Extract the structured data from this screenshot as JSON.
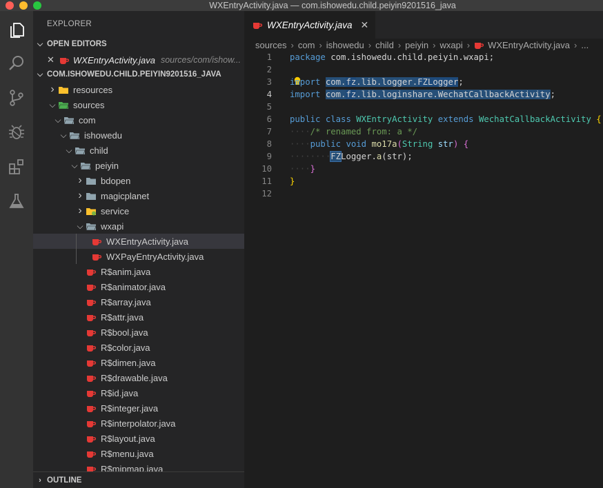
{
  "window": {
    "title": "WXEntryActivity.java — com.ishowedu.child.peiyin9201516_java"
  },
  "activity_bar": {
    "icons": [
      "files-icon",
      "search-icon",
      "source-control-icon",
      "debug-icon",
      "extensions-icon",
      "testing-icon"
    ]
  },
  "sidebar": {
    "title": "EXPLORER",
    "open_editors": {
      "header": "OPEN EDITORS",
      "items": [
        {
          "name": "WXEntryActivity.java",
          "path": "sources/com/ishow..."
        }
      ]
    },
    "project": {
      "header": "COM.ISHOWEDU.CHILD.PEIYIN9201516_JAVA",
      "tree": [
        {
          "label": "resources",
          "depth": 0,
          "kind": "folder-res",
          "expanded": false
        },
        {
          "label": "sources",
          "depth": 0,
          "kind": "folder-src",
          "expanded": true
        },
        {
          "label": "com",
          "depth": 1,
          "kind": "folder",
          "expanded": true
        },
        {
          "label": "ishowedu",
          "depth": 2,
          "kind": "folder",
          "expanded": true
        },
        {
          "label": "child",
          "depth": 3,
          "kind": "folder",
          "expanded": true
        },
        {
          "label": "peiyin",
          "depth": 4,
          "kind": "folder",
          "expanded": true
        },
        {
          "label": "bdopen",
          "depth": 5,
          "kind": "folder",
          "expanded": false
        },
        {
          "label": "magicplanet",
          "depth": 5,
          "kind": "folder",
          "expanded": false
        },
        {
          "label": "service",
          "depth": 5,
          "kind": "folder-svc",
          "expanded": false
        },
        {
          "label": "wxapi",
          "depth": 5,
          "kind": "folder",
          "expanded": true
        },
        {
          "label": "WXEntryActivity.java",
          "depth": 6,
          "kind": "java",
          "selected": true
        },
        {
          "label": "WXPayEntryActivity.java",
          "depth": 6,
          "kind": "java"
        },
        {
          "label": "R$anim.java",
          "depth": 5,
          "kind": "java"
        },
        {
          "label": "R$animator.java",
          "depth": 5,
          "kind": "java"
        },
        {
          "label": "R$array.java",
          "depth": 5,
          "kind": "java"
        },
        {
          "label": "R$attr.java",
          "depth": 5,
          "kind": "java"
        },
        {
          "label": "R$bool.java",
          "depth": 5,
          "kind": "java"
        },
        {
          "label": "R$color.java",
          "depth": 5,
          "kind": "java"
        },
        {
          "label": "R$dimen.java",
          "depth": 5,
          "kind": "java"
        },
        {
          "label": "R$drawable.java",
          "depth": 5,
          "kind": "java"
        },
        {
          "label": "R$id.java",
          "depth": 5,
          "kind": "java"
        },
        {
          "label": "R$integer.java",
          "depth": 5,
          "kind": "java"
        },
        {
          "label": "R$interpolator.java",
          "depth": 5,
          "kind": "java"
        },
        {
          "label": "R$layout.java",
          "depth": 5,
          "kind": "java"
        },
        {
          "label": "R$menu.java",
          "depth": 5,
          "kind": "java"
        },
        {
          "label": "R$mipmap.java",
          "depth": 5,
          "kind": "java"
        }
      ]
    },
    "outline": {
      "header": "OUTLINE"
    }
  },
  "editor": {
    "tab": {
      "label": "WXEntryActivity.java",
      "close": "✕"
    },
    "breadcrumb": [
      "sources",
      "com",
      "ishowedu",
      "child",
      "peiyin",
      "wxapi",
      "WXEntryActivity.java",
      "..."
    ],
    "active_line": 4,
    "lines": [
      [
        [
          "kw",
          "package"
        ],
        [
          "t",
          " com.ishowedu.child.peiyin.wxapi;"
        ]
      ],
      [],
      [
        [
          "kw",
          "import"
        ],
        [
          "t",
          " "
        ],
        [
          "hl",
          "com."
        ],
        [
          "hl2",
          "fz"
        ],
        [
          "hl",
          ".lib.logger."
        ],
        [
          "hl2",
          "FZLogger"
        ],
        [
          "t",
          ";"
        ]
      ],
      [
        [
          "kw",
          "import"
        ],
        [
          "t",
          " "
        ],
        [
          "hl",
          "com."
        ],
        [
          "hl2",
          "fz"
        ],
        [
          "hl",
          ".lib.loginshare.WechatCallbackActivity"
        ],
        [
          "t",
          ";"
        ]
      ],
      [],
      [
        [
          "kw",
          "public"
        ],
        [
          "t",
          " "
        ],
        [
          "kw",
          "class"
        ],
        [
          "t",
          " "
        ],
        [
          "cls",
          "WXEntryActivity"
        ],
        [
          "t",
          " "
        ],
        [
          "kw",
          "extends"
        ],
        [
          "t",
          " "
        ],
        [
          "cls",
          "WechatCallbackActivity"
        ],
        [
          "t",
          " "
        ],
        [
          "pn1",
          "{"
        ]
      ],
      [
        [
          "ws",
          "····"
        ],
        [
          "cmt",
          "/* renamed from: a */"
        ]
      ],
      [
        [
          "ws",
          "····"
        ],
        [
          "kw",
          "public"
        ],
        [
          "t",
          " "
        ],
        [
          "kw",
          "void"
        ],
        [
          "t",
          " "
        ],
        [
          "fn",
          "mo17a"
        ],
        [
          "pn2",
          "("
        ],
        [
          "cls",
          "String"
        ],
        [
          "t",
          " "
        ],
        [
          "prm",
          "str"
        ],
        [
          "pn2",
          ")"
        ],
        [
          "t",
          " "
        ],
        [
          "pn2",
          "{"
        ]
      ],
      [
        [
          "ws",
          "····"
        ],
        [
          "ws",
          "····"
        ],
        [
          "sel",
          "FZ"
        ],
        [
          "t",
          "Logger."
        ],
        [
          "fn",
          "a"
        ],
        [
          "t",
          "(str);"
        ]
      ],
      [
        [
          "ws",
          "····"
        ],
        [
          "pn2",
          "}"
        ]
      ],
      [
        [
          "pn1",
          "}"
        ]
      ],
      []
    ]
  },
  "colors": {
    "java_icon": "#e53935",
    "folder": "#90a4ae",
    "folder_res": "#fbc02d",
    "folder_src": "#4caf50",
    "folder_svc": "#fbc02d"
  }
}
